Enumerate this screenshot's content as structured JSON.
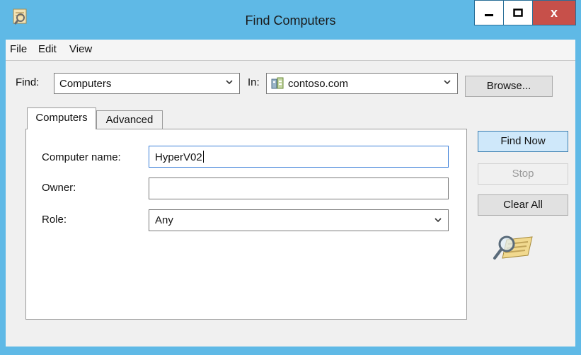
{
  "window": {
    "title": "Find Computers"
  },
  "window_controls": {
    "minimize": "minimize",
    "maximize": "maximize",
    "close": "x"
  },
  "menu": {
    "items": [
      "File",
      "Edit",
      "View"
    ]
  },
  "find": {
    "label": "Find:",
    "value": "Computers"
  },
  "in": {
    "label": "In:",
    "value": "contoso.com"
  },
  "buttons": {
    "browse": "Browse...",
    "find_now": "Find Now",
    "stop": "Stop",
    "clear_all": "Clear All"
  },
  "tabs": [
    "Computers",
    "Advanced"
  ],
  "fields": {
    "computer_name": {
      "label": "Computer name:",
      "value": "HyperV02"
    },
    "owner": {
      "label": "Owner:",
      "value": ""
    },
    "role": {
      "label": "Role:",
      "value": "Any"
    }
  },
  "icons": {
    "app": "search-directory-icon",
    "domain": "domain-icon",
    "search_animation": "magnifier-icon"
  }
}
